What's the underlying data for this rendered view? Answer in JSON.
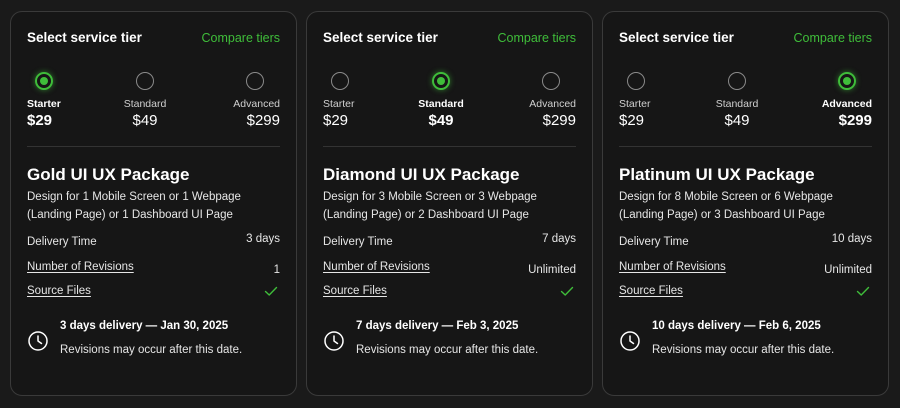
{
  "header": {
    "title": "Select service tier",
    "compare_link": "Compare tiers"
  },
  "accent_color": "#3fbd3a",
  "cards": [
    {
      "selected_tier": 0,
      "tiers": [
        {
          "name": "Starter",
          "price": "$29"
        },
        {
          "name": "Standard",
          "price": "$49"
        },
        {
          "name": "Advanced",
          "price": "$299"
        }
      ],
      "package_title": "Gold UI UX Package",
      "description": "Design for 1 Mobile Screen or 1 Webpage (Landing Page) or 1 Dashboard UI Page",
      "rows": {
        "delivery_label": "Delivery Time",
        "delivery_value": "3 days",
        "revisions_label": "Number of Revisions",
        "revisions_value": "1",
        "source_label": "Source Files",
        "source_icon": "checkmark-icon"
      },
      "delivery": {
        "title": "3 days delivery — Jan 30, 2025",
        "note": "Revisions may occur after this date."
      }
    },
    {
      "selected_tier": 1,
      "tiers": [
        {
          "name": "Starter",
          "price": "$29"
        },
        {
          "name": "Standard",
          "price": "$49"
        },
        {
          "name": "Advanced",
          "price": "$299"
        }
      ],
      "package_title": "Diamond UI UX Package",
      "description": "Design for 3 Mobile Screen or 3 Webpage (Landing Page) or 2 Dashboard UI Page",
      "rows": {
        "delivery_label": "Delivery Time",
        "delivery_value": "7 days",
        "revisions_label": "Number of Revisions",
        "revisions_value": "Unlimited",
        "source_label": "Source Files",
        "source_icon": "checkmark-icon"
      },
      "delivery": {
        "title": "7 days delivery — Feb 3, 2025",
        "note": "Revisions may occur after this date."
      }
    },
    {
      "selected_tier": 2,
      "tiers": [
        {
          "name": "Starter",
          "price": "$29"
        },
        {
          "name": "Standard",
          "price": "$49"
        },
        {
          "name": "Advanced",
          "price": "$299"
        }
      ],
      "package_title": "Platinum UI UX Package",
      "description": "Design for 8 Mobile Screen or 6 Webpage (Landing Page) or 3 Dashboard UI Page",
      "rows": {
        "delivery_label": "Delivery Time",
        "delivery_value": "10 days",
        "revisions_label": "Number of Revisions",
        "revisions_value": "Unlimited",
        "source_label": "Source Files",
        "source_icon": "checkmark-icon"
      },
      "delivery": {
        "title": "10 days delivery — Feb 6, 2025",
        "note": "Revisions may occur after this date."
      }
    }
  ]
}
